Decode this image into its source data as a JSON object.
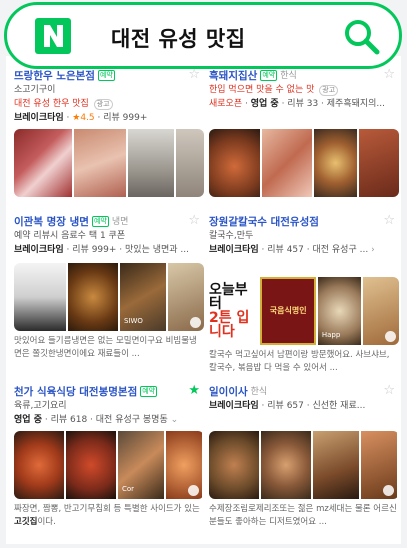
{
  "search": {
    "query": "대전 유성 맛집"
  },
  "cards": [
    {
      "title": "뜨랑한우 노은본점",
      "badge": "예약",
      "category": "",
      "subcategory": "소고기구이",
      "line2a": "대전 유성 한우 맛집",
      "line2b": "광고",
      "line3a": "브레이크타임",
      "line3b": "★4.5",
      "line3c": "리뷰 999+",
      "starred": false,
      "photo_label": "",
      "desc": ""
    },
    {
      "title": "흑돼지집산",
      "badge": "예약",
      "category": "한식",
      "subcategory": "",
      "line2a": "한입 먹으면 맛을 수 없는 맛",
      "line2b": "광고",
      "line3a": "새로오픈",
      "line3b": "영업 중",
      "line3c": "리뷰 33 · 제주흑돼지의...",
      "starred": false,
      "photo_label": "",
      "desc": ""
    },
    {
      "title": "이관복 명장 냉면",
      "badge": "예약",
      "category": "냉면",
      "subcategory": "",
      "line2a": "예약 리뷰시 음료수 택 1 쿠폰",
      "line2b": "",
      "line3a": "브레이크타임",
      "line3b": "리뷰 999+",
      "line3c": "맛있는 냉면과 ...",
      "starred": false,
      "photo_label": "SIWO",
      "desc": "맛있어요 들기름냉면은 없는 모밀면이구요 비빔물냉면은 쫄깃한냉면이에요 재료들이 ..."
    },
    {
      "title": "장원갈칼국수 대전유성점",
      "badge": "",
      "category": "",
      "subcategory": "칼국수,만두",
      "line2a": "",
      "line2b": "",
      "line3a": "브레이크타임",
      "line3b": "리뷰 457",
      "line3c": "대전 유성구 ...",
      "starred": false,
      "photo_label": "Happ",
      "poster_line1": "오늘부터",
      "poster_line2": "2튼 입니다",
      "sign_text": "국음식명인",
      "desc": "칼국수 먹고싶어서 남편이랑 방문했어요. 사브샤브, 칼국수, 볶음밥 다 먹을 수 있어서 ..."
    },
    {
      "title": "천가 식육식당 대전봉명본점",
      "badge": "예약",
      "category": "",
      "subcategory": "육류,고기요리",
      "line2a": "",
      "line2b": "",
      "line3a": "영업 중",
      "line3b": "리뷰 618",
      "line3c": "대전 유성구 봉명동",
      "starred": true,
      "photo_label": "Cor",
      "desc_pre": "짜장면, 짬뽕, 반고기무침회 등 특별한 사이드가 있는 ",
      "desc_bold": "고깃집",
      "desc_post": "이다."
    },
    {
      "title": "일이이사",
      "badge": "",
      "category": "한식",
      "subcategory": "",
      "line2a": "",
      "line2b": "",
      "line3a": "브레이크타임",
      "line3b": "리뷰 657",
      "line3c": "신선한 재료...",
      "starred": false,
      "photo_label": "",
      "desc": "수제장조림로제리조또는 젊은 mz세대는 물론 어르신분들도 좋아하는 디저트였어요 ..."
    }
  ]
}
